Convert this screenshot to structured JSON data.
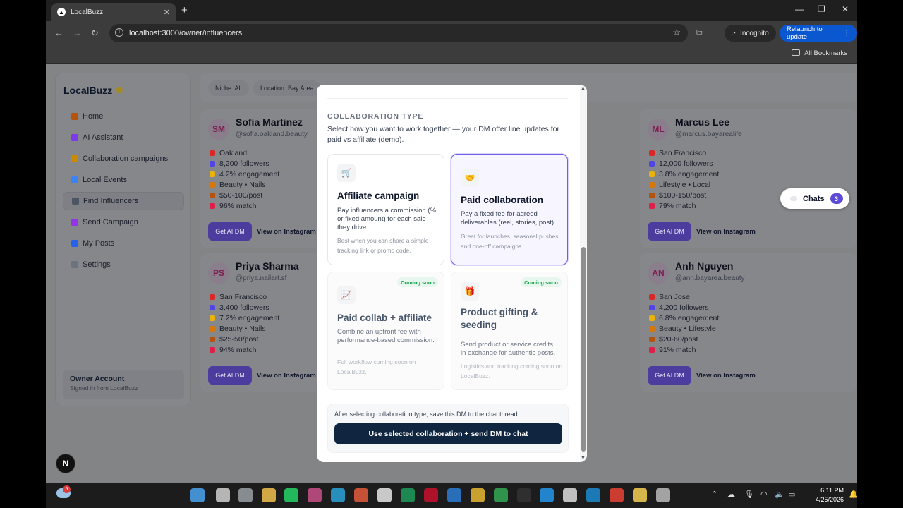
{
  "browser": {
    "tab_title": "LocalBuzz",
    "url": "localhost:3000/owner/influencers",
    "incognito_label": "Incognito",
    "relaunch_label": "Relaunch to update",
    "bookmarks_label": "All Bookmarks"
  },
  "sidebar": {
    "brand": "LocalBuzz",
    "items": [
      {
        "label": "Home",
        "color": "#b45309"
      },
      {
        "label": "AI Assistant",
        "color": "#7c3aed"
      },
      {
        "label": "Collaboration campaigns",
        "color": "#ca8a04"
      },
      {
        "label": "Local Events",
        "color": "#3b82f6"
      },
      {
        "label": "Find Influencers",
        "color": "#4b5563",
        "active": true
      },
      {
        "label": "Send Campaign",
        "color": "#9333ea"
      },
      {
        "label": "My Posts",
        "color": "#2563eb"
      },
      {
        "label": "Settings",
        "color": "#6b7280"
      }
    ],
    "owner_name": "Owner Account",
    "owner_sub": "Signed in from LocalBuzz"
  },
  "filters": {
    "niche": "Niche: All",
    "location": "Location: Bay Area"
  },
  "influencers": [
    {
      "initials": "SM",
      "name": "Sofia Martinez",
      "handle": "@sofia.oakland.beauty",
      "location": "Oakland",
      "followers": "8,200 followers",
      "engagement": "4.2% engagement",
      "niche": "Beauty • Nails",
      "price": "$50-100/post",
      "match": "96% match"
    },
    {
      "initials": "ML",
      "name": "Marcus Lee",
      "handle": "@marcus.bayarealife",
      "location": "San Francisco",
      "followers": "12,000 followers",
      "engagement": "3.8% engagement",
      "niche": "Lifestyle • Local",
      "price": "$100-150/post",
      "match": "79% match"
    },
    {
      "initials": "PS",
      "name": "Priya Sharma",
      "handle": "@priya.nailart.sf",
      "location": "San Francisco",
      "followers": "3,400 followers",
      "engagement": "7.2% engagement",
      "niche": "Beauty • Nails",
      "price": "$25-50/post",
      "match": "94% match"
    },
    {
      "initials": "AN",
      "name": "Anh Nguyen",
      "handle": "@anh.bayarea.beauty",
      "location": "San Jose",
      "followers": "4,200 followers",
      "engagement": "6.8% engagement",
      "niche": "Beauty • Lifestyle",
      "price": "$20-60/post",
      "match": "91% match"
    }
  ],
  "card_buttons": {
    "ai_dm": "Get AI DM",
    "instagram": "View on Instagram"
  },
  "chats": {
    "label": "Chats",
    "count": "3"
  },
  "modal": {
    "heading": "COLLABORATION TYPE",
    "description": "Select how you want to work together — your DM offer line updates for paid vs affiliate (demo).",
    "options": [
      {
        "title": "Affiliate campaign",
        "desc": "Pay influencers a commission (% or fixed amount) for each sale they drive.",
        "note": "Best when you can share a simple tracking link or promo code.",
        "icon": "cart-icon"
      },
      {
        "title": "Paid collaboration",
        "desc": "Pay a fixed fee for agreed deliverables (reel, stories, post).",
        "note": "Great for launches, seasonal pushes, and one-off campaigns.",
        "icon": "handshake-icon",
        "selected": true
      },
      {
        "title": "Paid collab + affiliate",
        "desc": "Combine an upfront fee with performance-based commission.",
        "note": "Full workflow coming soon on LocalBuzz.",
        "badge": "Coming soon",
        "icon": "chart-icon"
      },
      {
        "title": "Product gifting & seeding",
        "desc": "Send product or service credits in exchange for authentic posts.",
        "note": "Logistics and tracking coming soon on LocalBuzz.",
        "badge": "Coming soon",
        "icon": "gift-icon"
      }
    ],
    "footer_text": "After selecting collaboration type, save this DM to the chat thread.",
    "submit_label": "Use selected collaboration + send DM to chat"
  },
  "taskbar": {
    "time": "6:11 PM",
    "date": "4/25/2026",
    "weather_badge": "5"
  }
}
